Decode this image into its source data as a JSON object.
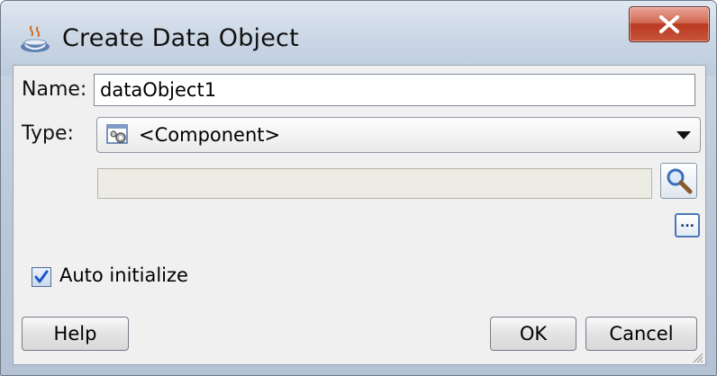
{
  "window": {
    "title": "Create Data Object",
    "close_glyph": "X"
  },
  "form": {
    "name_label": "Name:",
    "name_value": "dataObject1",
    "type_label": "Type:",
    "type_value": "<Component>",
    "component_value": "",
    "browse_glyph": "...",
    "auto_init_label": "Auto initialize",
    "auto_init_checked": true
  },
  "buttons": {
    "help": "Help",
    "ok": "OK",
    "cancel": "Cancel"
  },
  "icons": {
    "title": "coffee-cup-icon",
    "close": "close-icon",
    "type": "gear-component-icon",
    "search": "magnifier-icon",
    "dropdown": "chevron-down-icon",
    "check": "checkmark-icon",
    "grip": "resize-grip-icon"
  },
  "colors": {
    "close_button": "#c8553c",
    "checkbox_check": "#1d54c9",
    "ellipsis_border": "#4e76b6"
  }
}
